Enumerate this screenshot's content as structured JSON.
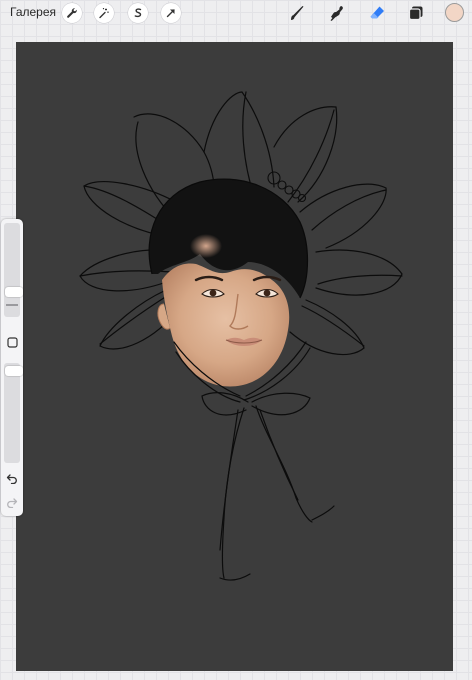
{
  "toolbar": {
    "gallery_label": "Галерея",
    "left_tools": [
      "wrench-icon",
      "magic-wand-icon",
      "selection-s-icon",
      "transform-arrow-icon"
    ],
    "right_tools": [
      "brush-icon",
      "smudge-icon",
      "eraser-icon",
      "layers-icon"
    ],
    "active_tool": "eraser",
    "accent_color": "#2f7cf6",
    "current_color": "#f2d6c6"
  },
  "sidebar": {
    "brush_size": 0.22,
    "brush_opacity": 0.0,
    "icons": [
      "square-modify-icon",
      "undo-icon",
      "redo-icon"
    ]
  },
  "canvas": {
    "background": "#3c3c3c"
  }
}
